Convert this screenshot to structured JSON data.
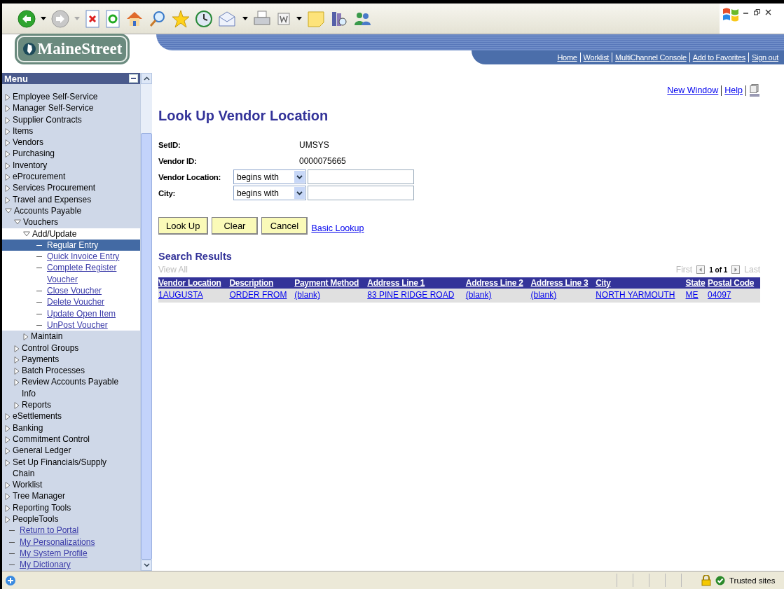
{
  "header": {
    "logo": "MaineStreet",
    "links": [
      "Home",
      "Worklist",
      "MultiChannel Console",
      "Add to Favorites",
      "Sign out"
    ]
  },
  "menu": {
    "title": "Menu",
    "items": [
      {
        "kind": "folder",
        "label": "Employee Self-Service",
        "expanded": false
      },
      {
        "kind": "folder",
        "label": "Manager Self-Service",
        "expanded": false
      },
      {
        "kind": "folder",
        "label": "Supplier Contracts",
        "expanded": false
      },
      {
        "kind": "folder",
        "label": "Items",
        "expanded": false
      },
      {
        "kind": "folder",
        "label": "Vendors",
        "expanded": false
      },
      {
        "kind": "folder",
        "label": "Purchasing",
        "expanded": false
      },
      {
        "kind": "folder",
        "label": "Inventory",
        "expanded": false
      },
      {
        "kind": "folder",
        "label": "eProcurement",
        "expanded": false
      },
      {
        "kind": "folder",
        "label": "Services Procurement",
        "expanded": false
      },
      {
        "kind": "folder",
        "label": "Travel and Expenses",
        "expanded": false
      },
      {
        "kind": "folder",
        "label": "Accounts Payable",
        "expanded": true,
        "children": [
          {
            "kind": "folder",
            "label": "Vouchers",
            "expanded": true,
            "children": [
              {
                "kind": "folder",
                "label": "Add/Update",
                "expanded": true,
                "children": [
                  {
                    "kind": "link",
                    "label": "Regular Entry",
                    "selected": true
                  },
                  {
                    "kind": "link",
                    "label": "Quick Invoice Entry",
                    "selected": false
                  },
                  {
                    "kind": "link",
                    "label": "Complete Register Voucher",
                    "selected": false
                  },
                  {
                    "kind": "link",
                    "label": "Close Voucher",
                    "selected": false
                  },
                  {
                    "kind": "link",
                    "label": "Delete Voucher",
                    "selected": false
                  },
                  {
                    "kind": "link",
                    "label": "Update Open Item",
                    "selected": false
                  },
                  {
                    "kind": "link",
                    "label": "UnPost Voucher",
                    "selected": false
                  }
                ]
              },
              {
                "kind": "folder",
                "label": "Maintain",
                "expanded": false
              }
            ]
          },
          {
            "kind": "folder",
            "label": "Control Groups",
            "expanded": false
          },
          {
            "kind": "folder",
            "label": "Payments",
            "expanded": false
          },
          {
            "kind": "folder",
            "label": "Batch Processes",
            "expanded": false
          },
          {
            "kind": "folder",
            "label": "Review Accounts Payable Info",
            "expanded": false
          },
          {
            "kind": "folder",
            "label": "Reports",
            "expanded": false
          }
        ]
      },
      {
        "kind": "folder",
        "label": "eSettlements",
        "expanded": false
      },
      {
        "kind": "folder",
        "label": "Banking",
        "expanded": false
      },
      {
        "kind": "folder",
        "label": "Commitment Control",
        "expanded": false
      },
      {
        "kind": "folder",
        "label": "General Ledger",
        "expanded": false
      },
      {
        "kind": "folder",
        "label": "Set Up Financials/Supply Chain",
        "expanded": false
      },
      {
        "kind": "folder",
        "label": "Worklist",
        "expanded": false
      },
      {
        "kind": "folder",
        "label": "Tree Manager",
        "expanded": false
      },
      {
        "kind": "folder",
        "label": "Reporting Tools",
        "expanded": false
      },
      {
        "kind": "folder",
        "label": "PeopleTools",
        "expanded": false
      },
      {
        "kind": "link",
        "label": "Return to Portal",
        "selected": false
      },
      {
        "kind": "link",
        "label": "My Personalizations",
        "selected": false
      },
      {
        "kind": "link",
        "label": "My System Profile",
        "selected": false
      },
      {
        "kind": "link",
        "label": "My Dictionary",
        "selected": false
      }
    ]
  },
  "page_links": [
    "New Window",
    "Help"
  ],
  "title": "Look Up Vendor Location",
  "fields": [
    {
      "kind": "static",
      "label": "SetID:",
      "value": "UMSYS"
    },
    {
      "kind": "static",
      "label": "Vendor ID:",
      "value": "0000075665"
    },
    {
      "kind": "search",
      "label": "Vendor Location:",
      "operator": "begins with"
    },
    {
      "kind": "search",
      "label": "City:",
      "operator": "begins with"
    }
  ],
  "buttons": [
    "Look Up",
    "Clear",
    "Cancel"
  ],
  "basic_lookup": "Basic Lookup",
  "results": {
    "title": "Search Results",
    "view_all": "View All",
    "first": "First",
    "count": "1 of 1",
    "last": "Last",
    "columns": [
      "Vendor Location",
      "Description",
      "Payment Method",
      "Address Line 1",
      "Address Line 2",
      "Address Line 3",
      "City",
      "State",
      "Postal Code"
    ],
    "rows": [
      [
        "1AUGUSTA",
        "ORDER FROM",
        "(blank)",
        "83 PINE RIDGE ROAD",
        "(blank)",
        "(blank)",
        "NORTH YARMOUTH",
        "ME",
        "04097"
      ]
    ]
  },
  "status_bar": {
    "zone": "Trusted sites"
  }
}
